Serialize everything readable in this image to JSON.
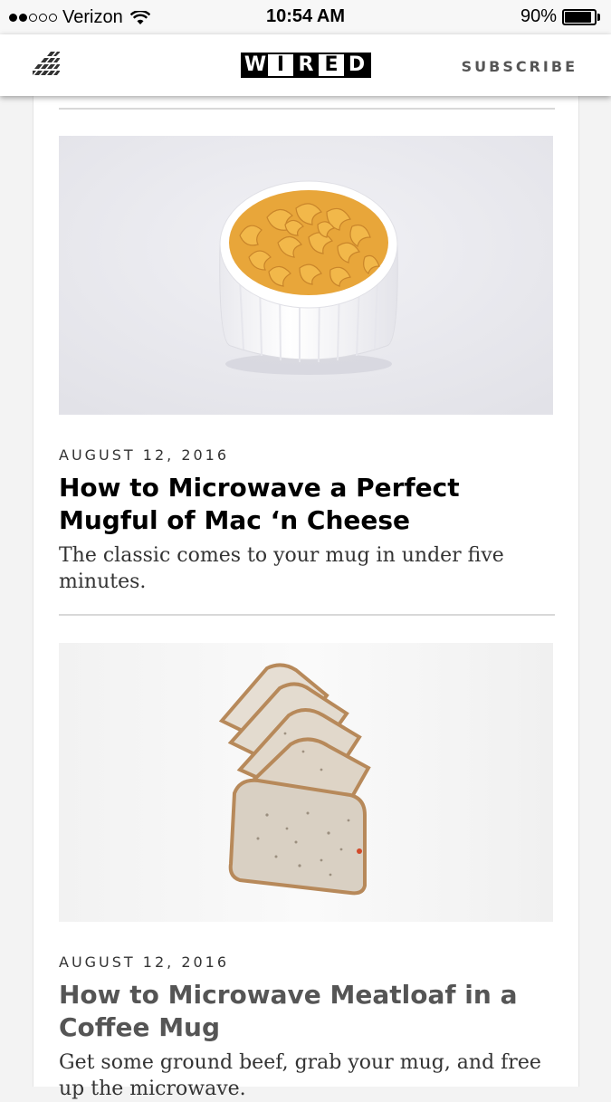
{
  "status_bar": {
    "carrier": "Verizon",
    "signal_bars_filled": 2,
    "signal_bars_total": 5,
    "time": "10:54 AM",
    "battery_percent": "90%",
    "battery_level": 0.9
  },
  "header": {
    "logo_letters": [
      "W",
      "I",
      "R",
      "E",
      "D"
    ],
    "subscribe_label": "SUBSCRIBE",
    "menu_icon": "grid-menu-icon"
  },
  "articles": [
    {
      "date": "AUGUST 12, 2016",
      "title": "How to Microwave a Perfect Mugful of Mac ‘n Cheese",
      "dek": "The classic comes to your mug in under five minutes.",
      "image": "mac-and-cheese-ramekin"
    },
    {
      "date": "AUGUST 12, 2016",
      "title": "How to Microwave Meatloaf in a Coffee Mug",
      "dek": "Get some ground beef, grab your mug, and free up the microwave.",
      "image": "sliced-meatloaf"
    }
  ],
  "colors": {
    "header_bg": "#ffffff",
    "page_bg": "#f3f3f3",
    "title": "#000000",
    "divider": "#d8d8d8"
  }
}
